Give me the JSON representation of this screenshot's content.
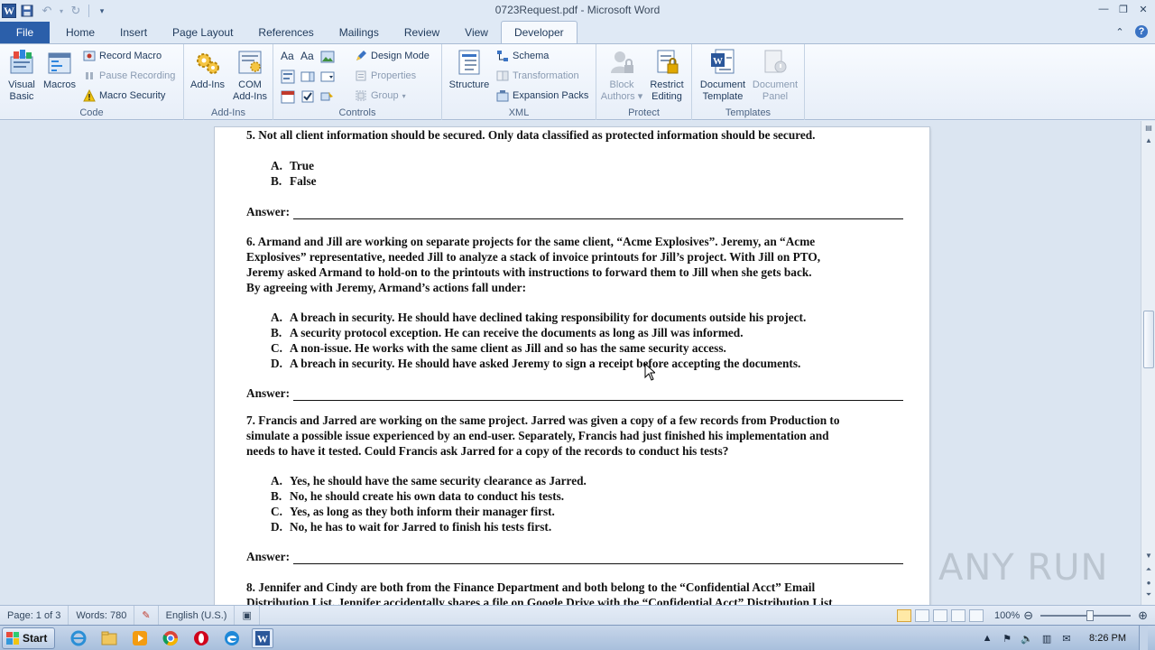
{
  "window": {
    "title": "0723Request.pdf - Microsoft Word",
    "app_icon": "word-logo",
    "controls": [
      "minimize",
      "restore",
      "close"
    ]
  },
  "tabs": {
    "file": "File",
    "items": [
      "Home",
      "Insert",
      "Page Layout",
      "References",
      "Mailings",
      "Review",
      "View",
      "Developer"
    ],
    "active": "Developer"
  },
  "ribbon": {
    "code": {
      "label": "Code",
      "visual_basic": "Visual\nBasic",
      "macros": "Macros",
      "record_macro": "Record Macro",
      "pause_recording": "Pause Recording",
      "macro_security": "Macro Security"
    },
    "addins": {
      "label": "Add-Ins",
      "add_ins": "Add-Ins",
      "com_add_ins": "COM\nAdd-Ins"
    },
    "controls": {
      "label": "Controls",
      "design_mode": "Design Mode",
      "properties": "Properties",
      "group": "Group"
    },
    "xml": {
      "label": "XML",
      "structure": "Structure",
      "schema": "Schema",
      "transformation": "Transformation",
      "expansion_packs": "Expansion Packs"
    },
    "protect": {
      "label": "Protect",
      "block_authors": "Block\nAuthors",
      "restrict_editing": "Restrict\nEditing"
    },
    "templates": {
      "label": "Templates",
      "document_template": "Document\nTemplate",
      "document_panel": "Document\nPanel"
    }
  },
  "document": {
    "q5": {
      "text": "5. Not all client information should be secured. Only data classified as protected information should be secured.",
      "options": [
        {
          "letter": "A.",
          "text": "True"
        },
        {
          "letter": "B.",
          "text": "False"
        }
      ]
    },
    "q6": {
      "lines": [
        "6. Armand and Jill are working on separate projects for the same client, “Acme Explosives”. Jeremy, an “Acme",
        "Explosives” representative, needed Jill to analyze a stack of invoice printouts for Jill’s project. With Jill on PTO,",
        "Jeremy asked Armand to hold-on to the printouts with instructions to forward them to Jill when she gets back.",
        "By agreeing with Jeremy, Armand’s actions fall under:"
      ],
      "options": [
        {
          "letter": "A.",
          "text": "A breach in security. He should have declined taking responsibility for documents outside his project."
        },
        {
          "letter": "B.",
          "text": "A security protocol exception. He can receive the documents as long as Jill was informed."
        },
        {
          "letter": "C.",
          "text": "A non-issue. He works with the same client as Jill and so has the same security access."
        },
        {
          "letter": "D.",
          "text": "A breach in security. He should have asked Jeremy to sign a receipt before accepting the documents."
        }
      ]
    },
    "q7": {
      "lines": [
        "7. Francis and Jarred are working on the same project. Jarred was given a copy of a few records from Production to",
        "simulate a possible issue experienced by an end-user. Separately, Francis had just finished his implementation and",
        "needs to have it tested. Could Francis ask Jarred for a copy of the records to conduct his tests?"
      ],
      "options": [
        {
          "letter": "A.",
          "text": "Yes, he should have the same security clearance as Jarred."
        },
        {
          "letter": "B.",
          "text": "No, he should create his own data to conduct his tests."
        },
        {
          "letter": "C.",
          "text": "Yes, as long as they both inform their manager first."
        },
        {
          "letter": "D.",
          "text": "No, he has to wait for Jarred to finish his tests first."
        }
      ]
    },
    "q8": {
      "lines": [
        "8.  Jennifer and Cindy are both from the Finance Department and both belong to the “Confidential Acct” Email",
        "Distribution List. Jennifer accidentally shares a file on Google Drive with the “Confidential Acct” Distribution List"
      ]
    },
    "answer_label": "Answer:"
  },
  "statusbar": {
    "page": "Page: 1 of 3",
    "words": "Words: 780",
    "language": "English (U.S.)",
    "zoom": "100%",
    "zoom_fraction": 0.55
  },
  "watermark": "ANY RUN",
  "taskbar": {
    "start": "Start",
    "time": "8:26 PM",
    "apps": [
      "ie-icon",
      "explorer-icon",
      "media-player-icon",
      "chrome-icon",
      "opera-icon",
      "edge-icon",
      "word-icon"
    ]
  }
}
